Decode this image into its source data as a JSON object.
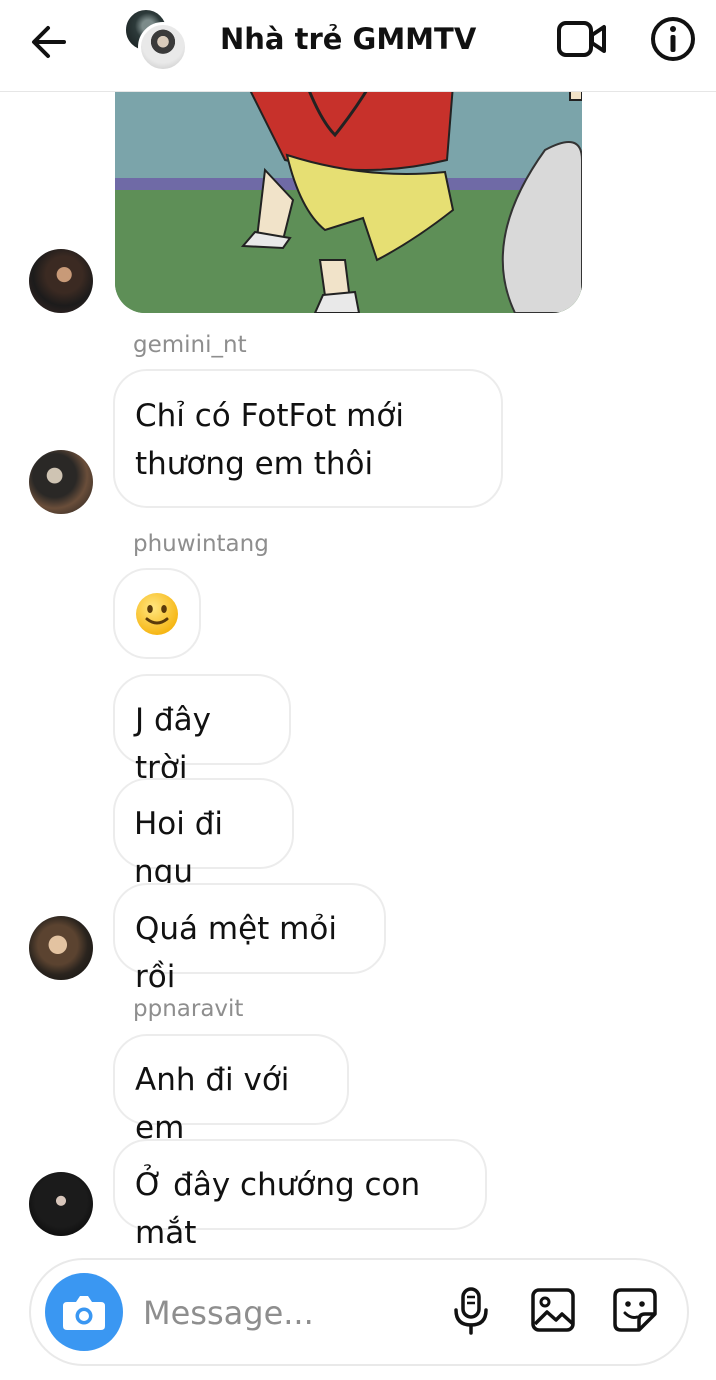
{
  "header": {
    "title": "Nhà trẻ GMMTV",
    "icons": [
      "back-arrow-icon",
      "video-camera-icon",
      "info-icon"
    ]
  },
  "messages": [
    {
      "sender": "gemini_nt",
      "texts": [
        "Chỉ có FotFot mới thương em thôi"
      ]
    },
    {
      "sender": "phuwintang",
      "texts": [
        "🙂",
        "J đây trời",
        "Hoi đi ngụ",
        "Quá mệt mỏi rồi"
      ]
    },
    {
      "sender": "ppnaravit",
      "texts": [
        "Anh đi với em",
        "Ở đây chướng con mắt"
      ]
    }
  ],
  "b1_line1": "Chỉ có FotFot mới",
  "b1_line2": "thương em thôi",
  "composer": {
    "placeholder": "Message...",
    "icons": [
      "camera-icon",
      "microphone-icon",
      "gallery-icon",
      "sticker-icon"
    ]
  },
  "colors": {
    "accent": "#3a97f2",
    "muted_text": "#8e8e8e",
    "bubble_border": "#ececec"
  }
}
